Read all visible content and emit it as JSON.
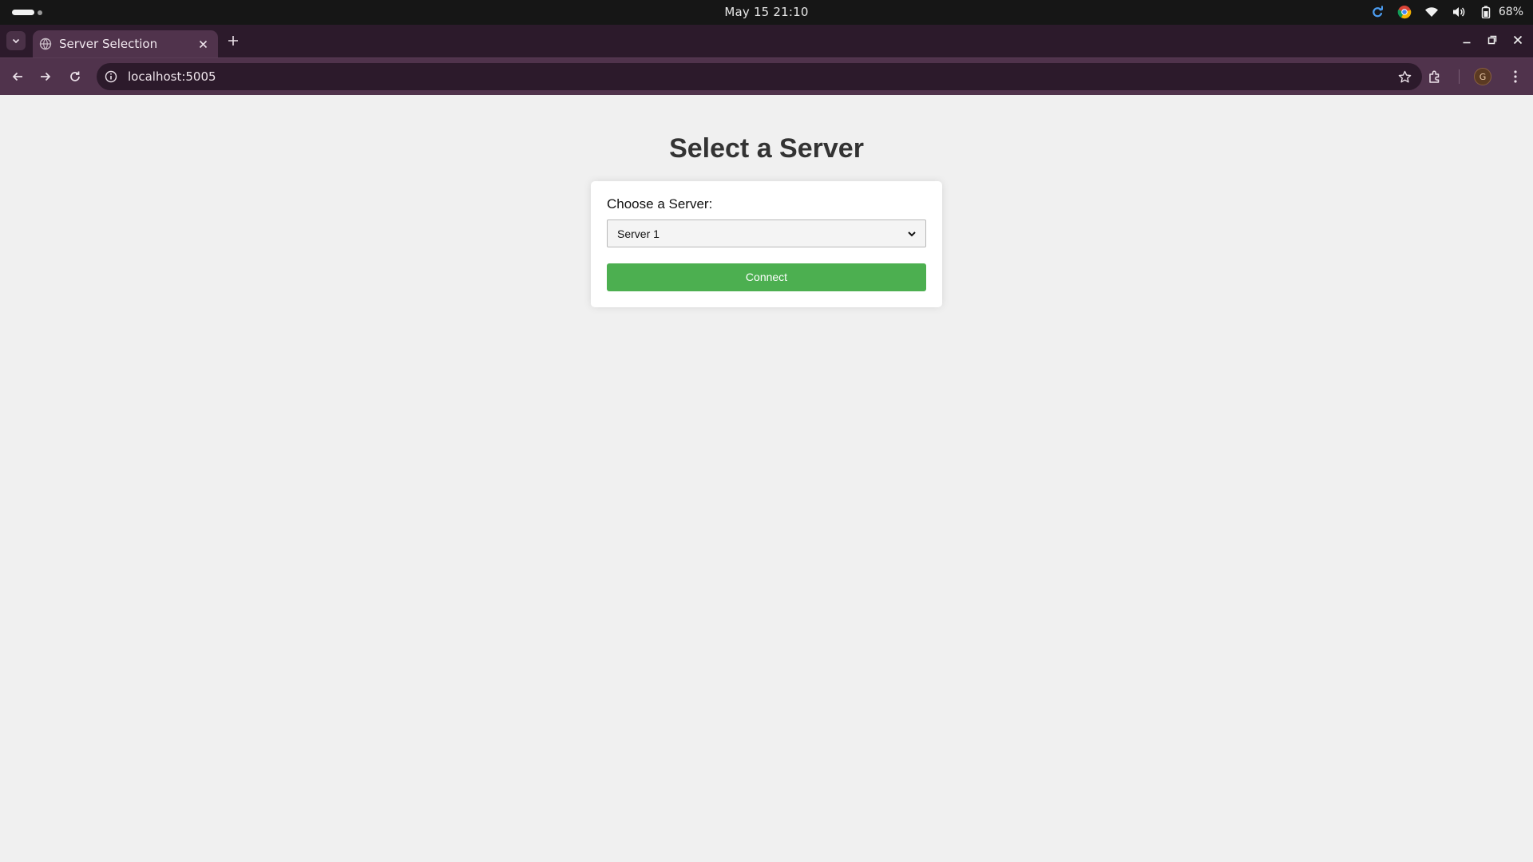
{
  "os": {
    "clock": "May 15  21:10",
    "battery_percent": "68%",
    "tray_icons": [
      "refresh-icon",
      "chrome-icon",
      "wifi-icon",
      "volume-icon",
      "battery-icon"
    ]
  },
  "browser": {
    "tab": {
      "title": "Server Selection",
      "favicon": "globe-icon"
    },
    "address": "localhost:5005",
    "profile_initial": "G"
  },
  "page": {
    "title": "Select a Server",
    "form": {
      "label": "Choose a Server:",
      "selected_server": "Server 1",
      "connect_label": "Connect"
    }
  },
  "colors": {
    "page_bg": "#f0f0f0",
    "connect_button": "#4caf50",
    "title_text": "#333333",
    "browser_frame": "#50334c"
  }
}
